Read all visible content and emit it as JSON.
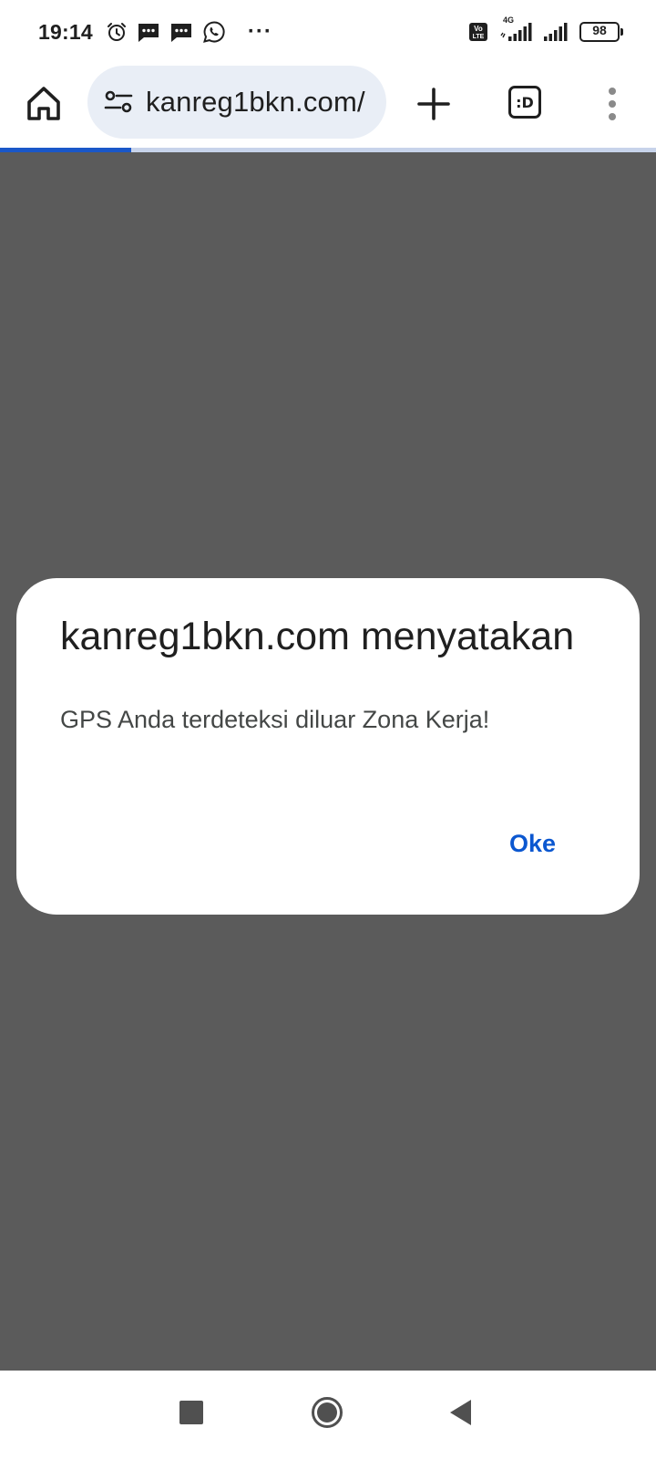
{
  "status_bar": {
    "time": "19:14",
    "more_notifications": "···",
    "network": "4G",
    "battery_level": "98",
    "left_icons": [
      "alarm-icon",
      "message-icon",
      "message-icon",
      "whatsapp-icon"
    ],
    "right_icons": [
      "volte-icon",
      "signal-icon",
      "signal-icon",
      "battery-icon"
    ]
  },
  "toolbar": {
    "url": "kanreg1bkn.com/",
    "tab_switcher_label": ":D",
    "icons": [
      "home-icon",
      "site-settings-icon",
      "plus-icon",
      "tab-switcher-icon",
      "more-vert-icon"
    ]
  },
  "progress": {
    "fraction": 0.2
  },
  "dialog": {
    "title": "kanreg1bkn.com menyatakan",
    "message": "GPS Anda terdeteksi diluar Zona Kerja!",
    "ok_label": "Oke"
  },
  "colors": {
    "accent": "#0b57d0",
    "progress": "#1a57c8",
    "scrim": "#5b5b5b",
    "omnibox": "#e9eef6"
  },
  "nav_bar": {
    "icons": [
      "recents-icon",
      "home-circle-icon",
      "back-icon"
    ]
  }
}
